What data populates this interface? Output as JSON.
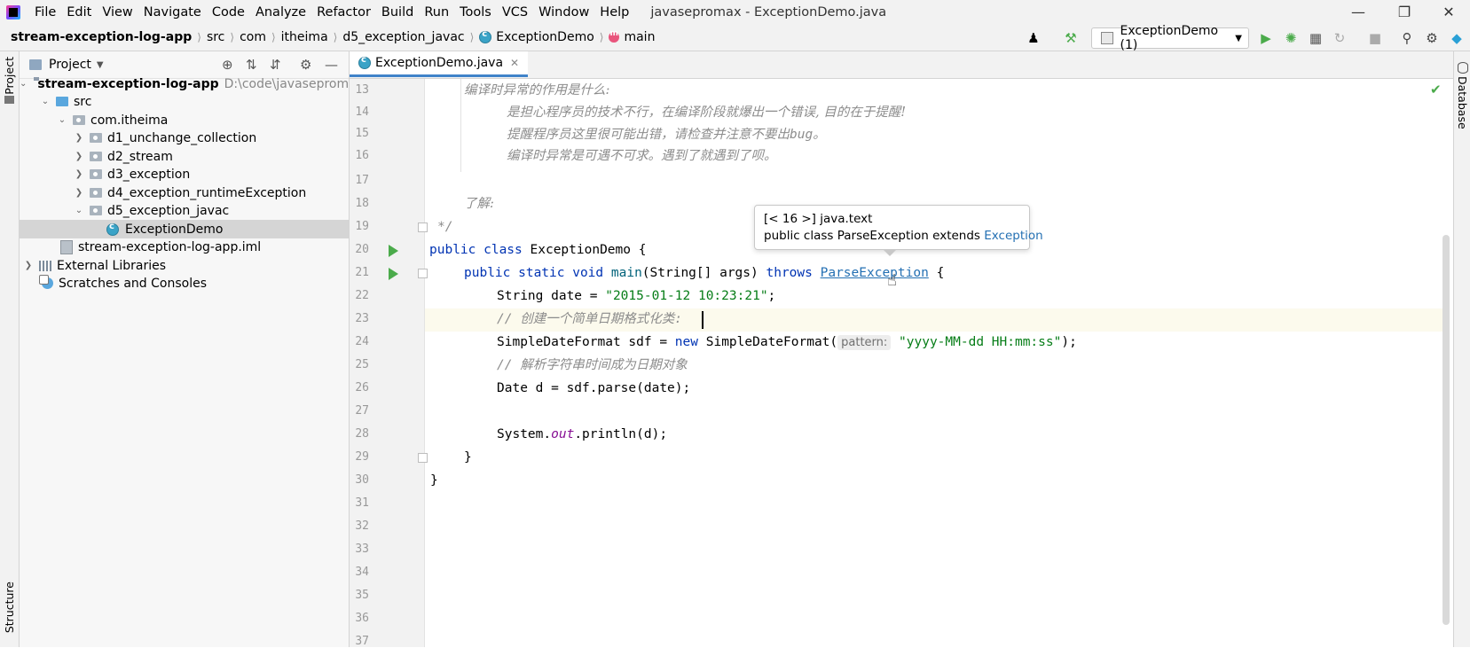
{
  "menubar": {
    "items": [
      "File",
      "Edit",
      "View",
      "Navigate",
      "Code",
      "Analyze",
      "Refactor",
      "Build",
      "Run",
      "Tools",
      "VCS",
      "Window",
      "Help"
    ],
    "title": "javasepromax - ExceptionDemo.java"
  },
  "breadcrumb": {
    "items": [
      "stream-exception-log-app",
      "src",
      "com",
      "itheima",
      "d5_exception_javac",
      "ExceptionDemo",
      "main"
    ]
  },
  "run_config": {
    "label": "ExceptionDemo (1)"
  },
  "left_strip": {
    "project_tab": "Project",
    "structure_tab": "Structure"
  },
  "right_strip": {
    "database_tab": "Database"
  },
  "project_panel": {
    "title": "Project",
    "tree": [
      {
        "label": "stream-exception-log-app",
        "path": "D:\\code\\javasepromax\\"
      },
      {
        "label": "src"
      },
      {
        "label": "com.itheima"
      },
      {
        "label": "d1_unchange_collection"
      },
      {
        "label": "d2_stream"
      },
      {
        "label": "d3_exception"
      },
      {
        "label": "d4_exception_runtimeException"
      },
      {
        "label": "d5_exception_javac"
      },
      {
        "label": "ExceptionDemo"
      },
      {
        "label": "stream-exception-log-app.iml"
      },
      {
        "label": "External Libraries"
      },
      {
        "label": "Scratches and Consoles"
      }
    ]
  },
  "editor": {
    "tab": "ExceptionDemo.java",
    "line_numbers": [
      "13",
      "14",
      "15",
      "16",
      "17",
      "18",
      "19",
      "20",
      "21",
      "22",
      "23",
      "24",
      "25",
      "26",
      "27",
      "28",
      "29",
      "30",
      "31",
      "32",
      "33",
      "34",
      "35",
      "36",
      "37"
    ],
    "lines": {
      "l13": "编译时异常的作用是什么:",
      "l14": "是担心程序员的技术不行，在编译阶段就爆出一个错误, 目的在于提醒!",
      "l15_a": "提醒程序员这里很可能出错，请检查并注意不要出",
      "l15_b": "bug",
      "l15_c": "。",
      "l16": "编译时异常是可遇不可求。遇到了就遇到了呗。",
      "l18": "了解:",
      "l19": "*/",
      "l20_kw": "public class",
      "l20_rest": "ExceptionDemo {",
      "l21_kw": "public static void",
      "l21_fn": "main",
      "l21_args": "(String[] args)",
      "l21_throws": "throws",
      "l21_exc": "ParseException",
      "l21_end": "{",
      "l22_a": "String date = ",
      "l22_str": "\"2015-01-12 10:23:21\"",
      "l22_end": ";",
      "l23": "// 创建一个简单日期格式化类:",
      "l24_a": "SimpleDateFormat sdf = ",
      "l24_kw": "new",
      "l24_b": " SimpleDateFormat(",
      "l24_hint": "pattern:",
      "l24_str": "\"yyyy-MM-dd HH:mm:ss\"",
      "l24_end": ");",
      "l25": "// 解析字符串时间成为日期对象",
      "l26": "Date d = sdf.parse(date);",
      "l28_a": "System.",
      "l28_field": "out",
      "l28_b": ".println(d);",
      "l29": "}",
      "l30": "}"
    }
  },
  "tooltip": {
    "line1": "[< 16 >] java.text",
    "line2_a": "public class ParseException extends ",
    "line2_link": "Exception"
  },
  "colors": {
    "accent": "#4083c9",
    "keyword": "#0033b3",
    "string": "#067d17",
    "comment": "#8c8c8c",
    "run": "#4bab4b"
  }
}
